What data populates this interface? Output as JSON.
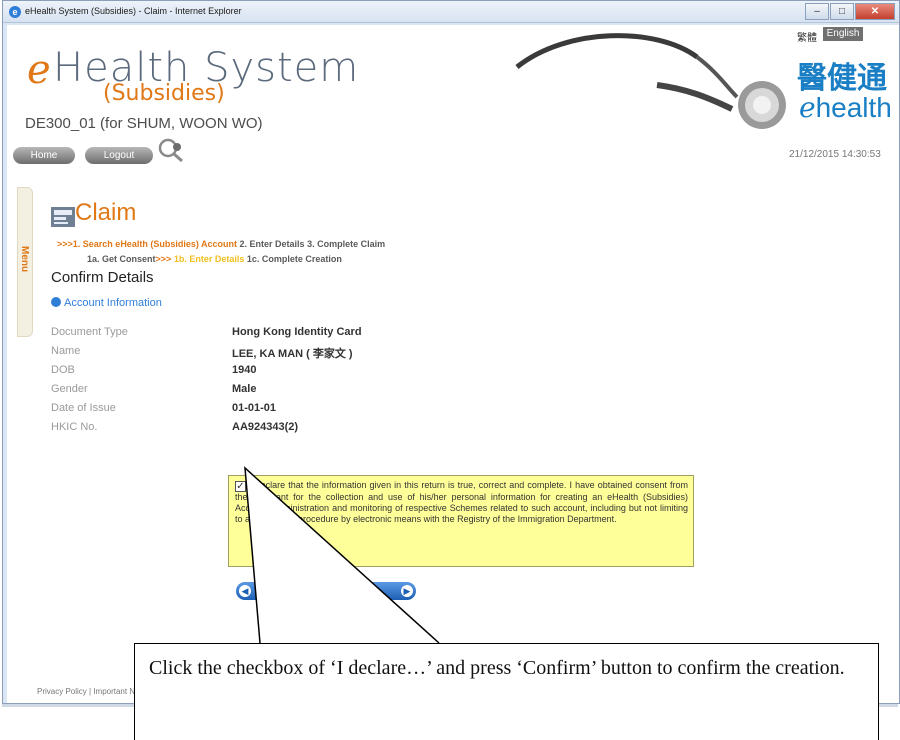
{
  "window": {
    "title": "eHealth System (Subsidies) - Claim - Internet Explorer",
    "buttons": [
      "–",
      "□",
      "✕"
    ]
  },
  "header": {
    "logo_e": "e",
    "logo_main": "Health System",
    "logo_sub": "(Subsidies)",
    "sp_id": "DE300_01 (for SHUM, WOON WO)",
    "lang_tc": "繁體",
    "lang_en": "English",
    "brand_cn": "醫健通",
    "brand_en_e": "e",
    "brand_en": "health",
    "datetime": "21/12/2015 14:30:53",
    "home_label": "Home",
    "logout_label": "Logout"
  },
  "side_menu": {
    "label": "Menu"
  },
  "claim": {
    "title": "Claim",
    "steps_row1": {
      "prefix": ">>>",
      "step1": "1. Search eHealth (Subsidies) Account",
      "step2": "2. Enter Details",
      "step3": "3. Complete Claim"
    },
    "steps_row2": {
      "sub1": "1a. Get Consent",
      "arrow": ">>>",
      "sub2": "1b. Enter Details",
      "sub3": "1c. Complete Creation"
    },
    "section_title": "Confirm Details",
    "account_heading": "Account Information",
    "fields": [
      {
        "label": "Document Type",
        "value": "Hong Kong Identity Card"
      },
      {
        "label": "Name",
        "value": "LEE, KA MAN ( 李家文 )"
      },
      {
        "label": "DOB",
        "value": "1940"
      },
      {
        "label": "Gender",
        "value": "Male"
      },
      {
        "label": "Date of Issue",
        "value": "01-01-01"
      },
      {
        "label": "HKIC No.",
        "value": "AA924343(2)"
      }
    ],
    "declaration": {
      "checked": true,
      "text": "I declare that the information given in this return is true, correct and complete. I have obtained consent from the applicant for the collection and use of his/her personal information for creating an eHealth (Subsidies) Account, administration and monitoring of respective Schemes related to such account, including but not limiting to a verification procedure by electronic means with the Registry of the Immigration Department."
    },
    "confirm_button": "Confirm"
  },
  "footer": {
    "privacy": "Privacy Policy | Important Notices"
  },
  "callout": {
    "text": "Click the checkbox of ‘I declare…’ and press ‘Confirm’ button to confirm the creation."
  }
}
